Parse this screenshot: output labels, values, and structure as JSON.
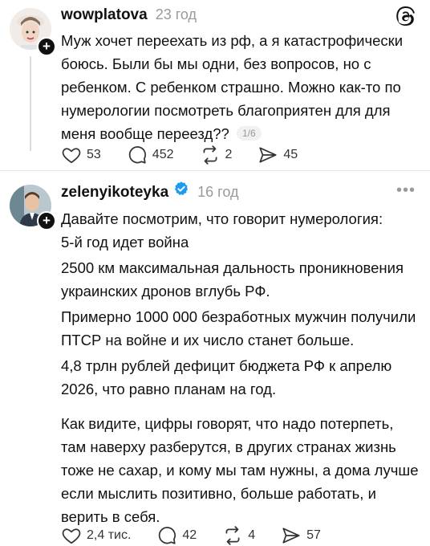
{
  "posts": [
    {
      "username": "wowplatova",
      "time": "23 год",
      "text": "Муж хочет переехать из рф, а я катастрофически боюсь. Были бы мы одни, без вопросов, но с ребенком. С ребенком страшно. Можно как-то по нумерологии посмотреть благоприятен для для меня вообще переезд??",
      "counter": "1/6",
      "likes": "53",
      "replies": "452",
      "reposts": "2",
      "shares": "45"
    },
    {
      "username": "zelenyikoteyka",
      "time": "16 год",
      "verified": true,
      "paragraphs": [
        "Давайте посмотрим, что говорит нумерология:",
        "5-й год идет война",
        "2500 км максимальная дальность проникновения украинских дронов вглубь РФ.",
        "Примерно 1000 000 безработных мужчин получили ПТСР на войне и их число станет больше.",
        "4,8 трлн рублей дефицит бюджета РФ к апрелю 2026, что равно планам на год.",
        "Как видите, цифры говорят, что надо потерпеть, там наверху разберутся, в других странах жизнь тоже не сахар, и кому мы там нужны, а дома лучше если мыслить позитивно, больше работать, и верить в себя."
      ],
      "likes": "2,4 тис.",
      "replies": "42",
      "reposts": "4",
      "shares": "57"
    }
  ],
  "icons": {
    "corner": "threads-logo-icon",
    "more": "more-options-icon",
    "like": "heart-icon",
    "reply": "comment-icon",
    "repost": "repost-icon",
    "share": "share-icon",
    "verified": "verified-badge-icon",
    "follow": "follow-plus-icon"
  },
  "colors": {
    "verified": "#1d9bf0",
    "muted": "#9a9a9a"
  }
}
